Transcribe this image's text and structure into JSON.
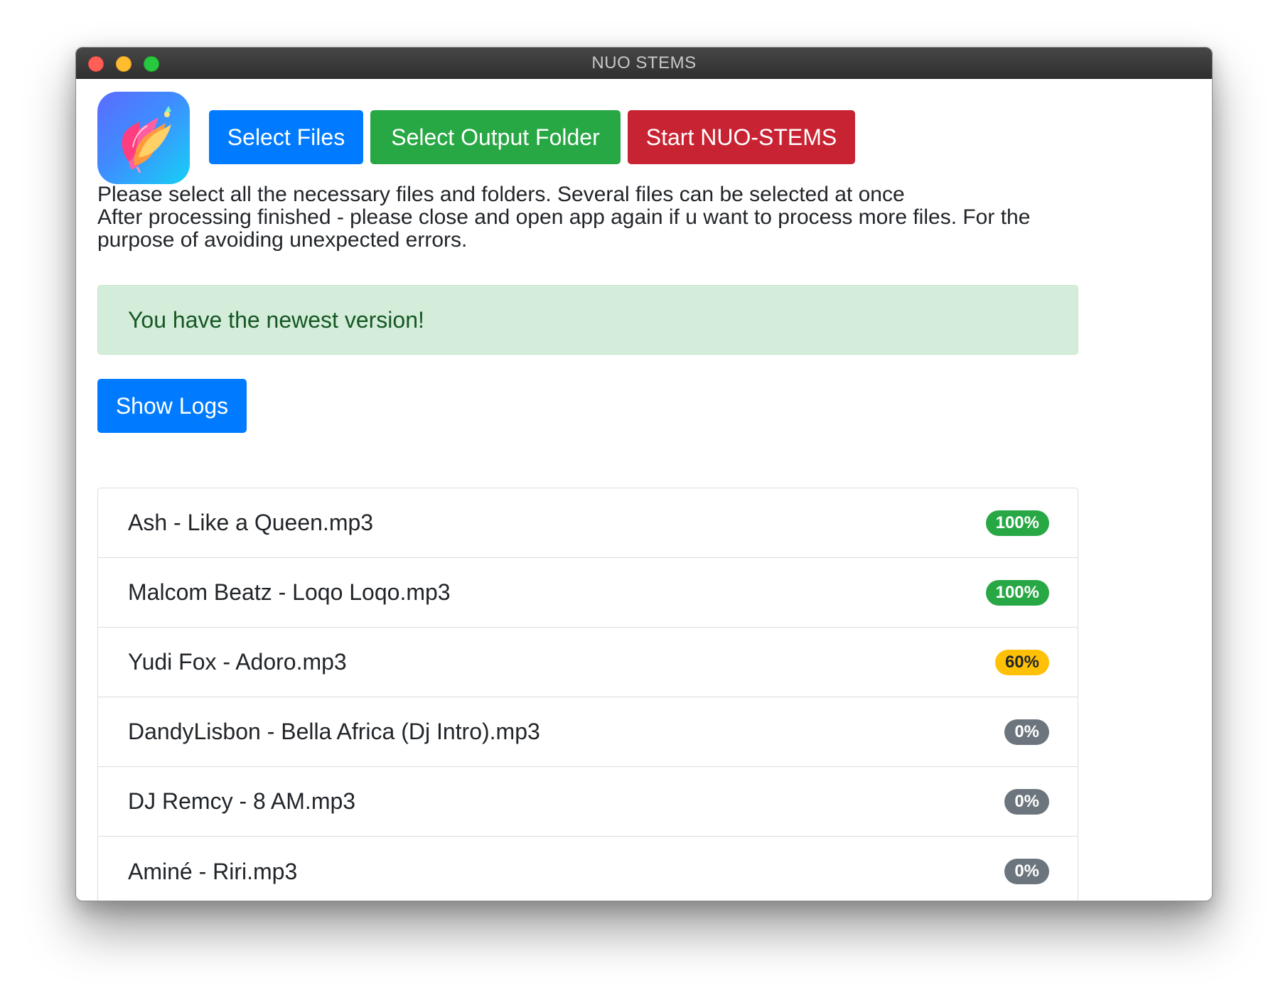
{
  "window": {
    "title": "NUO STEMS"
  },
  "toolbar": {
    "select_files_label": "Select Files",
    "select_output_label": "Select Output Folder",
    "start_label": "Start NUO-STEMS"
  },
  "instructions": {
    "line1": "Please select all the necessary files and folders. Several files can be selected at once",
    "line2": "After processing finished - please close and open app again if u want to process more files. For the purpose of avoiding unexpected errors."
  },
  "alert": {
    "message": "You have the newest version!"
  },
  "logs": {
    "button_label": "Show Logs"
  },
  "files": [
    {
      "name": "Ash - Like a Queen.mp3",
      "progress": "100%",
      "status": "success"
    },
    {
      "name": "Malcom Beatz - Loqo Loqo.mp3",
      "progress": "100%",
      "status": "success"
    },
    {
      "name": "Yudi Fox - Adoro.mp3",
      "progress": "60%",
      "status": "warning"
    },
    {
      "name": "DandyLisbon - Bella Africa (Dj Intro).mp3",
      "progress": "0%",
      "status": "secondary"
    },
    {
      "name": "DJ Remcy - 8 AM.mp3",
      "progress": "0%",
      "status": "secondary"
    },
    {
      "name": "Aminé - Riri.mp3",
      "progress": "0%",
      "status": "secondary"
    }
  ],
  "colors": {
    "primary": "#007bff",
    "success": "#28a745",
    "danger": "#c82333",
    "warning": "#ffc107",
    "secondary": "#6c757d",
    "alert_bg": "#d4edda",
    "alert_text": "#155724"
  },
  "icons": {
    "app_icon": "feather-flower-icon"
  }
}
